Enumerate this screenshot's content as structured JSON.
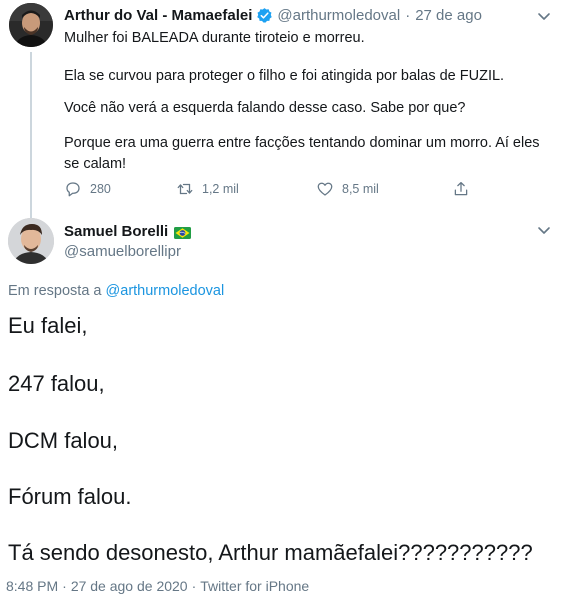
{
  "parent_tweet": {
    "author_name": "Arthur do Val - Mamaefalei",
    "handle": "@arthurmoledoval",
    "separator": "·",
    "date": "27 de ago",
    "paragraphs": [
      "Mulher foi BALEADA durante tiroteio e morreu.",
      "Ela se curvou para proteger o filho e foi atingida por balas de FUZIL.",
      "Você não verá a esquerda falando desse caso. Sabe por que?",
      "Porque era uma guerra entre facções tentando dominar um morro. Aí eles se calam!"
    ],
    "stats": {
      "replies": "280",
      "retweets": "1,2 mil",
      "likes": "8,5 mil"
    },
    "icons": {
      "verified": "verified-badge-icon",
      "reply": "reply-icon",
      "retweet": "retweet-icon",
      "like": "heart-icon",
      "share": "share-icon",
      "more": "chevron-down-icon"
    },
    "accent_color": "#1da1f2"
  },
  "reply_tweet": {
    "author_name": "Samuel Borelli",
    "handle": "@samuelborellipr",
    "flag_icon": "brazil-flag-icon",
    "in_reply_prefix": "Em resposta a",
    "in_reply_handle": "@arthurmoledoval",
    "lines": [
      "Eu falei,",
      "247 falou,",
      "DCM falou,",
      "Fórum falou.",
      "Tá sendo desonesto, Arthur mamãefalei???????????"
    ],
    "time": "8:48 PM",
    "date": "27 de ago de 2020",
    "separator": "·",
    "source": "Twitter for iPhone"
  },
  "colors": {
    "text": "#14171a",
    "secondary": "#657786",
    "link": "#1b95e0",
    "thread_line": "#ccd6dd"
  }
}
